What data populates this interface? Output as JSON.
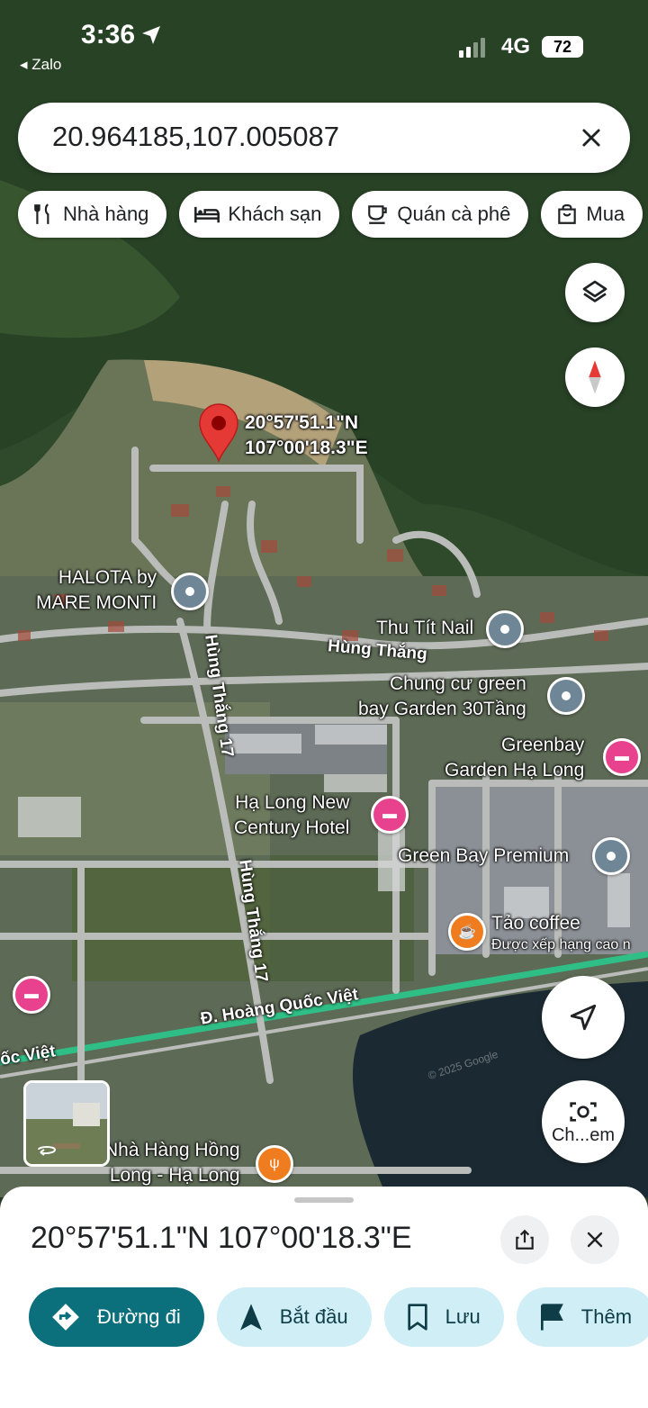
{
  "status_bar": {
    "time": "3:36",
    "back_app": "Zalo",
    "network": "4G",
    "battery": "72"
  },
  "search": {
    "query": "20.964185,107.005087"
  },
  "chips": [
    {
      "label": "Nhà hàng",
      "icon": "fork-knife-icon"
    },
    {
      "label": "Khách sạn",
      "icon": "bed-icon"
    },
    {
      "label": "Quán cà phê",
      "icon": "coffee-cup-icon"
    },
    {
      "label": "Mua",
      "icon": "shopping-bag-icon"
    }
  ],
  "map": {
    "dropped_pin": {
      "line1": "20°57'51.1\"N",
      "line2": "107°00'18.3\"E"
    },
    "places": {
      "halota": {
        "line1": "HALOTA by",
        "line2": "MARE MONTI"
      },
      "thu_tit_nail": "Thu Tít Nail",
      "chung_cu": {
        "line1": "Chung cư green",
        "line2": "bay Garden 30Tầng"
      },
      "greenbay_garden": {
        "line1": "Greenbay",
        "line2": "Garden Hạ Long"
      },
      "ha_long_new_century": {
        "line1": "Hạ Long New",
        "line2": "Century Hotel"
      },
      "green_bay_premium": "Green Bay Premium",
      "tao_coffee": {
        "name": "Tảo coffee",
        "sub": "Được xếp hạng cao n"
      },
      "nha_hang_hong_long": {
        "line1": "Nhà Hàng Hồng",
        "line2": "Long - Hạ Long"
      }
    },
    "roads": {
      "hung_thang": "Hùng Thắng",
      "hung_thang_17_top": "Hùng Thắng 17",
      "hung_thang_17_bottom": "Hùng Thắng 17",
      "hoang_quoc_viet": "Đ. Hoàng Quốc Việt",
      "quoc_viet_left": "ốc Việt"
    },
    "watermark": "© 2025 Google",
    "lens_label": "Ch...em"
  },
  "sheet": {
    "title": "20°57'51.1\"N 107°00'18.3\"E",
    "actions": [
      {
        "label": "Đường đi",
        "icon": "directions-icon"
      },
      {
        "label": "Bắt đầu",
        "icon": "navigation-arrow-icon"
      },
      {
        "label": "Lưu",
        "icon": "bookmark-icon"
      },
      {
        "label": "Thêm",
        "icon": "flag-icon"
      }
    ]
  },
  "colors": {
    "primary": "#0b6f7c",
    "secondary_bg": "#cfeef5",
    "pin_red": "#e53935",
    "pin_gray": "#6f8696",
    "pin_pink": "#e8428f",
    "pin_orange": "#ef7c1f"
  }
}
